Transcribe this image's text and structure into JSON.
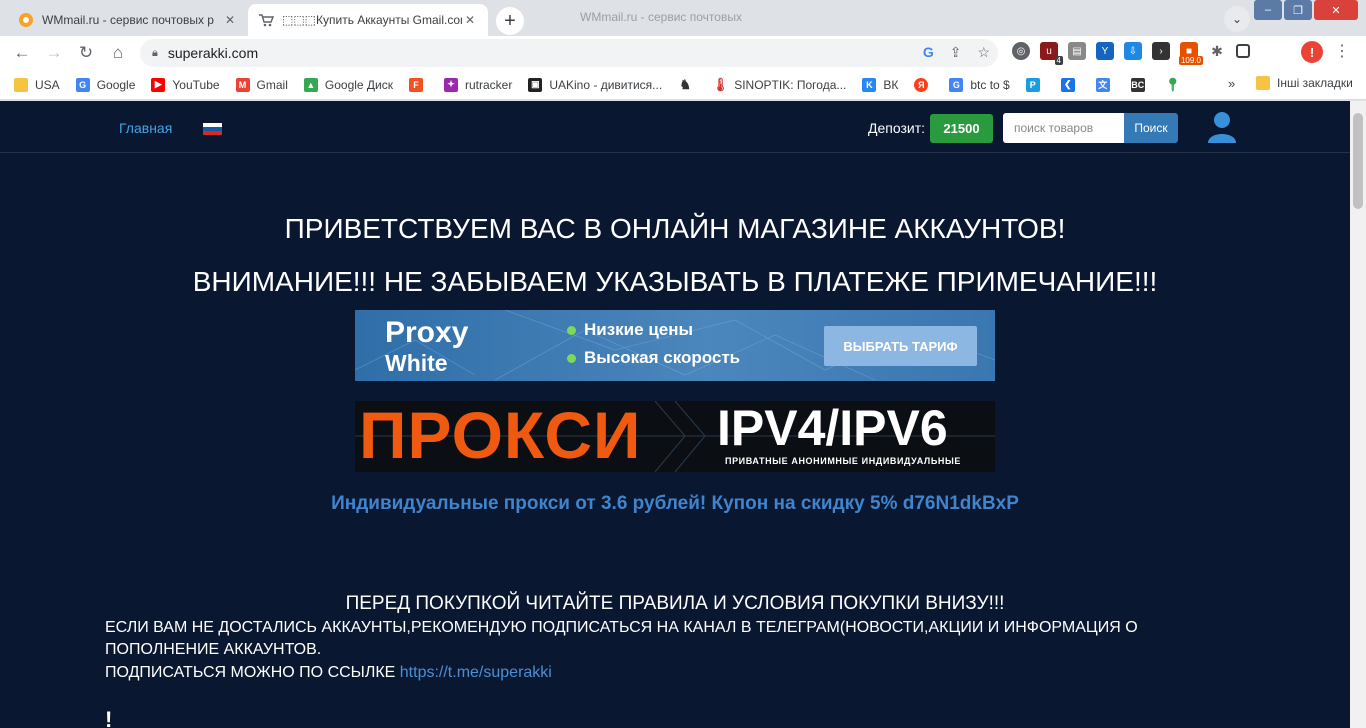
{
  "tabs": [
    {
      "title": "WMmail.ru - сервис почтовых р",
      "close": "✕"
    },
    {
      "title": "⬚⬚⬚Купить Аккаунты Gmail.com",
      "close": "✕"
    }
  ],
  "new_tab": "+",
  "background_tab": "WMmail.ru - сервис почтовых",
  "toolbar": {
    "url": "superakki.com"
  },
  "extensions": {
    "badge_4": "4",
    "badge_109": "109.0"
  },
  "profile_initial": "!",
  "bookmarks": [
    {
      "label": "USA",
      "color": "#f6c343"
    },
    {
      "label": "Google",
      "color": "#4285f4"
    },
    {
      "label": "YouTube",
      "color": "#ff0000"
    },
    {
      "label": "Gmail",
      "color": "#ea4335"
    },
    {
      "label": "Google Диск",
      "color": "#34a853"
    },
    {
      "label": "",
      "color": "#f4511e"
    },
    {
      "label": "rutracker",
      "color": "#9c27b0"
    },
    {
      "label": "UAKino - дивитися...",
      "color": "#222222"
    },
    {
      "label": "",
      "color": "#333333"
    },
    {
      "label": "SINOPTIK: Погода...",
      "color": "#d32f2f"
    },
    {
      "label": "ВК",
      "color": "#2787f5"
    },
    {
      "label": "",
      "color": "#fc3f1d"
    },
    {
      "label": "btc to $",
      "color": "#4285f4"
    },
    {
      "label": "",
      "color": "#1a9de0"
    },
    {
      "label": "",
      "color": "#1a73e8"
    },
    {
      "label": "",
      "color": "#4285f4"
    },
    {
      "label": "",
      "color": "#333333"
    },
    {
      "label": "",
      "color": "#34a853"
    }
  ],
  "bookmarks_more": "»",
  "bookmarks_other": "Інші закладки",
  "site": {
    "nav_home": "Главная",
    "deposit_label": "Депозит:",
    "deposit_value": "21500",
    "search_placeholder": "поиск товаров",
    "search_button": "Поиск",
    "welcome": "ПРИВЕТСТВУЕМ ВАС В ОНЛАЙН МАГАЗИНЕ АККАУНТОВ!",
    "attention": "ВНИМАНИЕ!!! НЕ ЗАБЫВАЕМ УКАЗЫВАТЬ В ПЛАТЕЖЕ ПРИМЕЧАНИЕ!!!",
    "banner1": {
      "brand1": "Proxy",
      "brand2": "White",
      "bullet1": "Низкие цены",
      "bullet2": "Высокая скорость",
      "button": "ВЫБРАТЬ ТАРИФ"
    },
    "banner2": {
      "big": "ПРОКСИ",
      "ipv": "IPV4/IPV6",
      "sub": "ПРИВАТНЫЕ АНОНИМНЫЕ ИНДИВИДУАЛЬНЫЕ"
    },
    "promo": "Индивидуальные прокси от 3.6 рублей! Купон на скидку 5% d76N1dkBxP",
    "rules_heading": "ПЕРЕД ПОКУПКОЙ ЧИТАЙТЕ ПРАВИЛА И УСЛОВИЯ ПОКУПКИ ВНИЗУ!!!",
    "line1": "ЕСЛИ ВАМ НЕ ДОСТАЛИСЬ АККАУНТЫ,РЕКОМЕНДУЮ ПОДПИСАТЬСЯ НА КАНАЛ В ТЕЛЕГРАМ(НОВОСТИ,АКЦИИ И ИНФОРМАЦИЯ О",
    "line2": "ПОПОЛНЕНИЕ АККАУНТОВ.",
    "line3_prefix": "ПОДПИСАТЬСЯ МОЖНО ПО ССЫЛКЕ ",
    "telegram_link": "https://t.me/superakki",
    "exclaim": "!"
  }
}
